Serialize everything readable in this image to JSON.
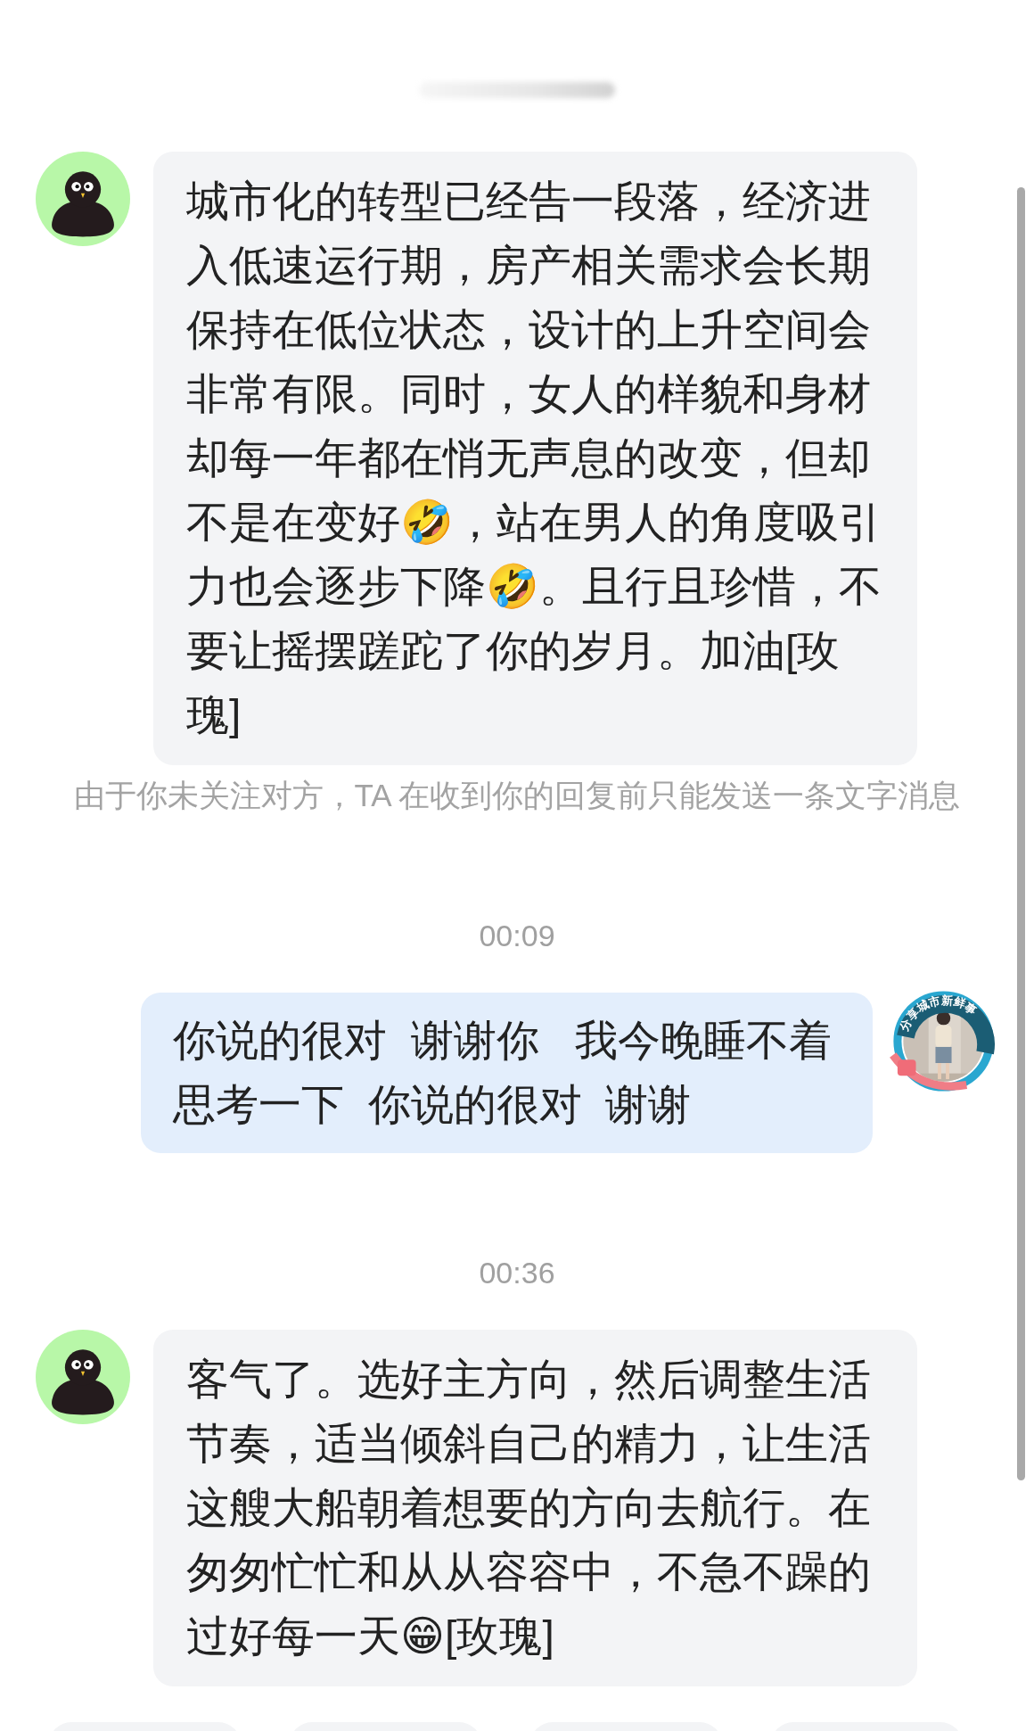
{
  "messages": [
    {
      "kind": "received",
      "text": "城市化的转型已经告一段落，经济进入低速运行期，房产相关需求会长期保持在低位状态，设计的上升空间会非常有限。同时，女人的样貌和身材却每一年都在悄无声息的改变，但却不是在变好🤣，站在男人的角度吸引力也会逐步下降🤣。且行且珍惜，不要让摇摆蹉跎了你的岁月。加油[玫瑰]"
    },
    {
      "kind": "notice",
      "text": "由于你未关注对方，TA 在收到你的回复前只能发送一条文字消息"
    },
    {
      "kind": "time",
      "text": "00:09"
    },
    {
      "kind": "sent",
      "text": "你说的很对  谢谢你   我今晚睡不着思考一下  你说的很对  谢谢",
      "avatar_badge": "分享城市新鲜事"
    },
    {
      "kind": "time",
      "text": "00:36"
    },
    {
      "kind": "received",
      "text": "客气了。选好主方向，然后调整生活节奏，适当倾斜自己的精力，让生活这艘大船朝着想要的方向去航行。在匆匆忙忙和从从容容中，不急不躁的过好每一天😁[玫瑰]"
    }
  ]
}
